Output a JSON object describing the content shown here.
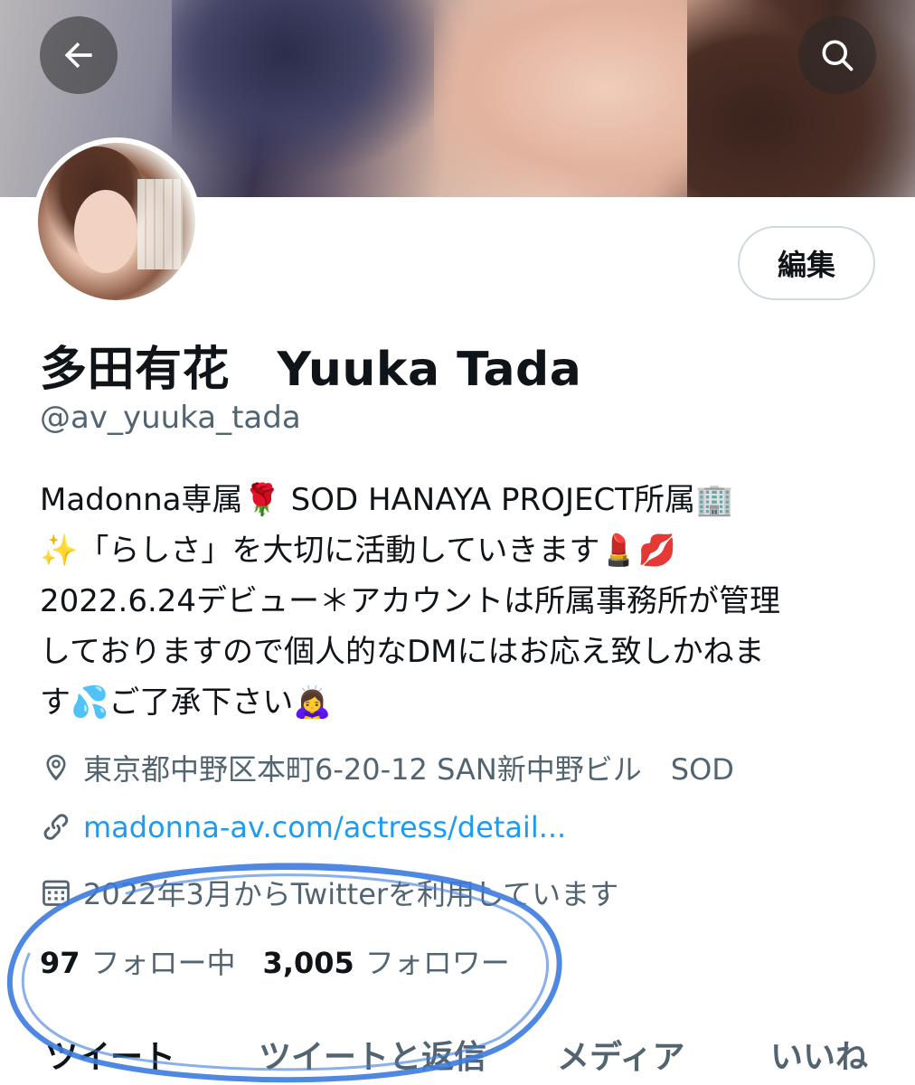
{
  "header": {
    "back_icon": "arrow-left-icon",
    "search_icon": "search-icon"
  },
  "profile": {
    "edit_label": "編集",
    "name": "多田有花　Yuuka Tada",
    "handle": "@av_yuuka_tada",
    "bio": {
      "line1_a": "Madonna専属",
      "line1_rose": "🌹",
      "line1_b": " SOD HANAYA PROJECT所属",
      "line1_office": "🏢",
      "line2_sparkle": "✨",
      "line2_a": "「らしさ」を大切に活動していきます",
      "line2_lipstick": "💄",
      "line2_kiss": "💋",
      "line3": "2022.6.24デビュー＊アカウントは所属事務所が管理",
      "line4": "しておりますので個人的なDMにはお応え致しかねま",
      "line5_a": "す",
      "line5_sweat": "💦",
      "line5_b": "ご了承下さい",
      "line5_bow": "🙇‍♀️"
    },
    "location": "東京都中野区本町6-20-12 SAN新中野ビル　SOD",
    "link": "madonna-av.com/actress/detail...",
    "joined": "2022年3月からTwitterを利用しています",
    "following_count": "97",
    "following_label": "フォロー中",
    "followers_count": "3,005",
    "followers_label": "フォロワー"
  },
  "tabs": [
    {
      "label": "ツイート",
      "active": true
    },
    {
      "label": "ツイートと返信",
      "active": false
    },
    {
      "label": "メディア",
      "active": false
    },
    {
      "label": "いいね",
      "active": false
    }
  ],
  "colors": {
    "accent": "#1d9bf0",
    "text_primary": "#0f1419",
    "text_secondary": "#536471",
    "annotation": "#3b7be0"
  }
}
